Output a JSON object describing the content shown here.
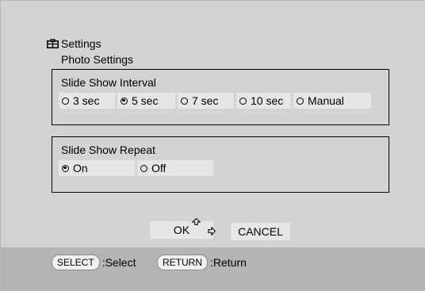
{
  "header": {
    "title": "Settings",
    "subtitle": "Photo Settings",
    "icon": "settings-toolbox-icon"
  },
  "interval": {
    "label": "Slide Show Interval",
    "selected": "5 sec",
    "options": [
      "3 sec",
      "5 sec",
      "7 sec",
      "10 sec",
      "Manual"
    ]
  },
  "repeat": {
    "label": "Slide Show Repeat",
    "selected": "On",
    "options": [
      "On",
      "Off"
    ]
  },
  "buttons": {
    "ok": "OK",
    "cancel": "CANCEL"
  },
  "footer": {
    "select_key": "SELECT",
    "select_action": ":Select",
    "return_key": "RETURN",
    "return_action": ":Return"
  },
  "colors": {
    "screen_bg": "#d3d3d3",
    "footer_bg": "#b4b4b4",
    "option_bg": "#e6e6e6"
  }
}
